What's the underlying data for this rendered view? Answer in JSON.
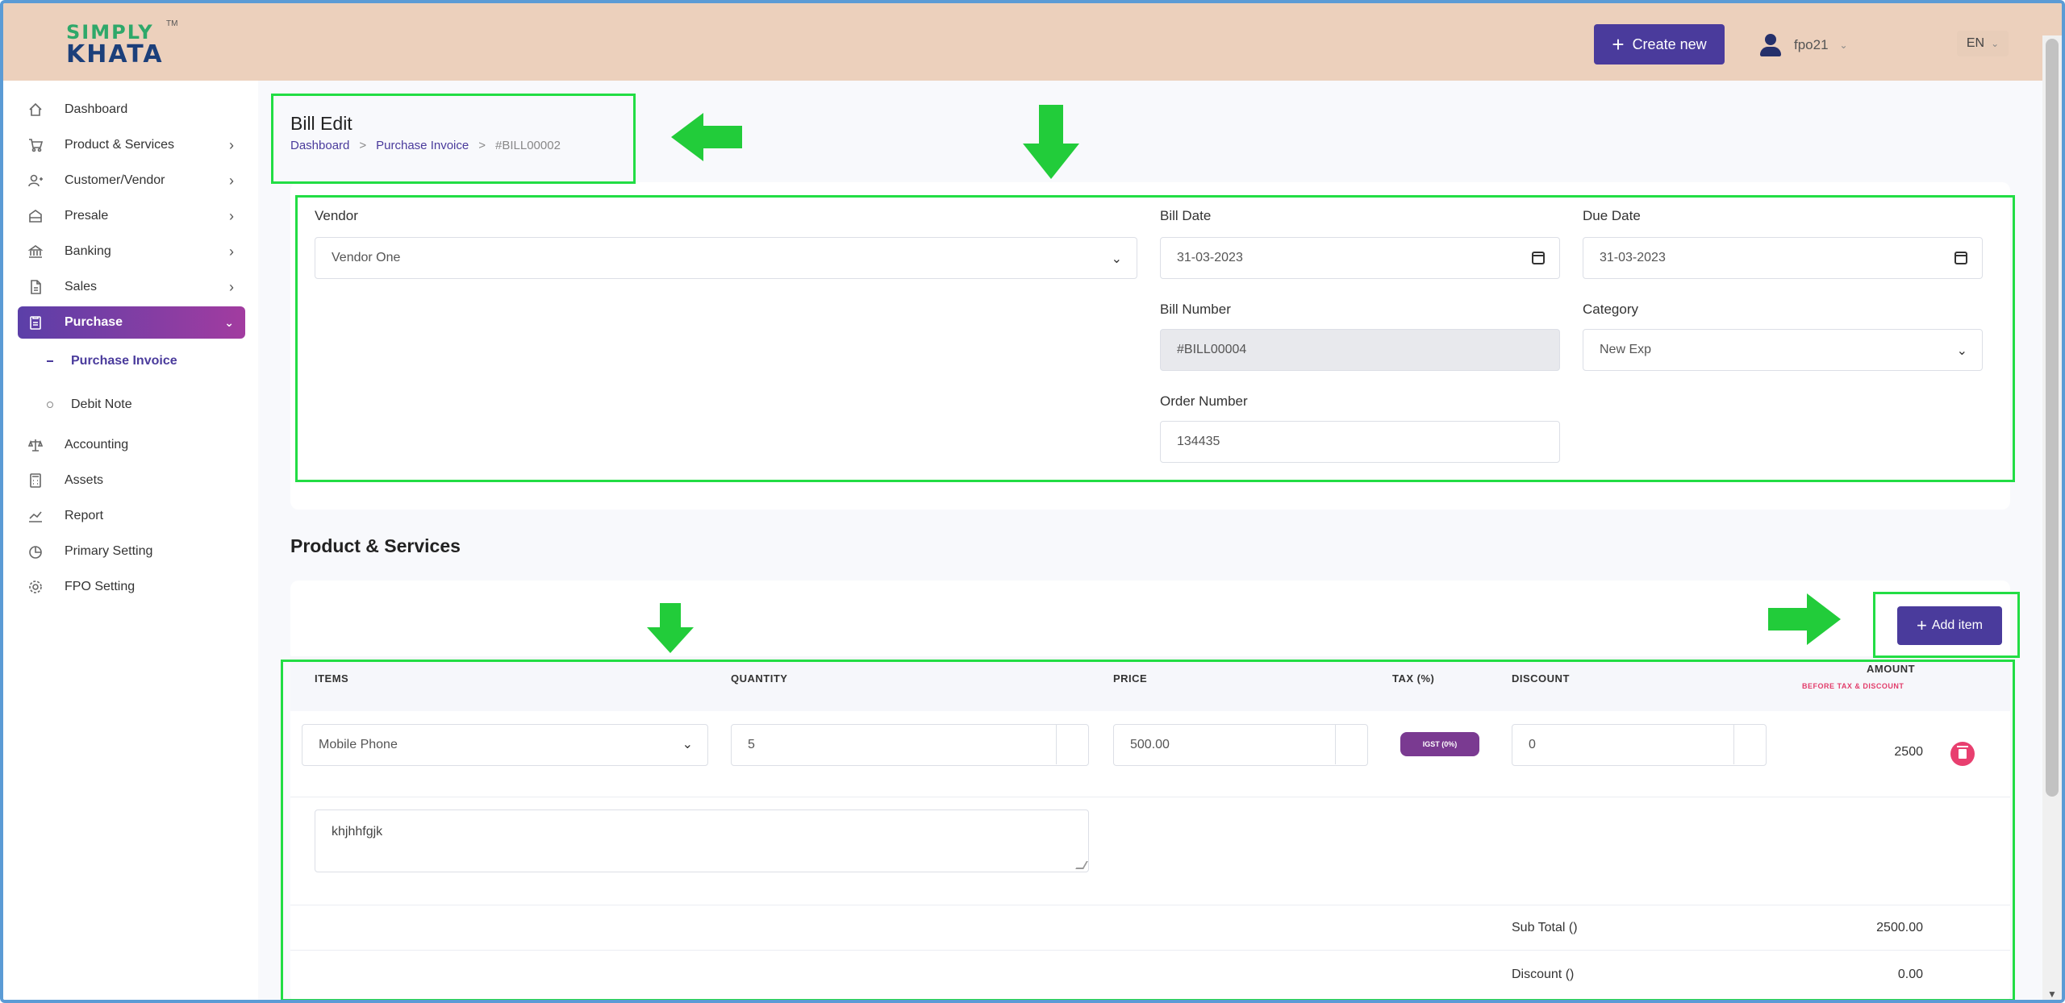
{
  "header": {
    "logo_top": "SIMPLY",
    "logo_bottom": "KHATA",
    "logo_tm": "TM",
    "create_label": "Create new",
    "user_name": "fpo21",
    "lang": "EN"
  },
  "sidebar": {
    "items": [
      {
        "label": "Dashboard",
        "icon": "home-icon"
      },
      {
        "label": "Product & Services",
        "icon": "cart-icon"
      },
      {
        "label": "Customer/Vendor",
        "icon": "user-add-icon"
      },
      {
        "label": "Presale",
        "icon": "building-icon"
      },
      {
        "label": "Banking",
        "icon": "bank-icon"
      },
      {
        "label": "Sales",
        "icon": "document-icon"
      },
      {
        "label": "Purchase",
        "icon": "clipboard-icon"
      },
      {
        "label": "Accounting",
        "icon": "scale-icon"
      },
      {
        "label": "Assets",
        "icon": "calculator-icon"
      },
      {
        "label": "Report",
        "icon": "chart-icon"
      },
      {
        "label": "Primary Setting",
        "icon": "pie-icon"
      },
      {
        "label": "FPO Setting",
        "icon": "gear-icon"
      }
    ],
    "sub_items": [
      {
        "label": "Purchase Invoice"
      },
      {
        "label": "Debit Note"
      }
    ]
  },
  "page": {
    "title": "Bill Edit",
    "breadcrumb": [
      "Dashboard",
      "Purchase Invoice",
      "#BILL00002"
    ],
    "breadcrumb_sep": ">"
  },
  "form": {
    "vendor_label": "Vendor",
    "vendor_value": "Vendor One",
    "bill_date_label": "Bill Date",
    "bill_date_value": "31-03-2023",
    "due_date_label": "Due Date",
    "due_date_value": "31-03-2023",
    "bill_number_label": "Bill Number",
    "bill_number_value": "#BILL00004",
    "category_label": "Category",
    "category_value": "New Exp",
    "order_number_label": "Order Number",
    "order_number_value": "134435"
  },
  "products": {
    "section_title": "Product & Services",
    "add_item_label": "Add item",
    "columns": {
      "items": "ITEMS",
      "quantity": "QUANTITY",
      "price": "PRICE",
      "tax": "TAX (%)",
      "discount": "DISCOUNT",
      "amount": "AMOUNT",
      "amount_sub": "BEFORE TAX & DISCOUNT"
    },
    "row": {
      "item": "Mobile Phone",
      "quantity": "5",
      "price": "500.00",
      "tax": "IGST (0%)",
      "discount": "0",
      "amount": "2500",
      "description": "khjhhfgjk"
    },
    "summary": {
      "sub_total_label": "Sub Total ()",
      "sub_total_value": "2500.00",
      "discount_label": "Discount ()",
      "discount_value": "0.00"
    }
  },
  "colors": {
    "accent": "#4a3b9c",
    "header_bg": "#ecd0bc",
    "highlight": "#22dd44",
    "danger": "#e83f6f"
  }
}
